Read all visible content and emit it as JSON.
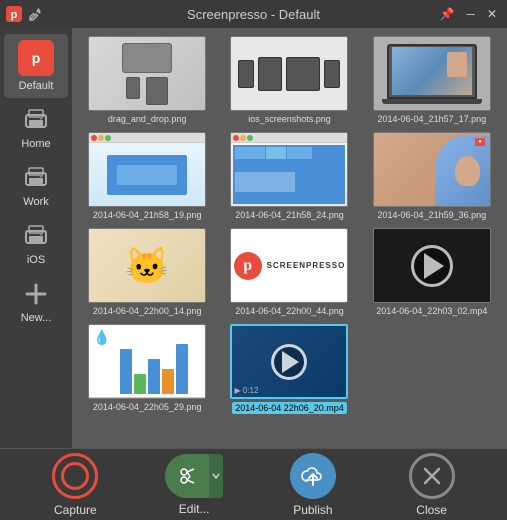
{
  "window": {
    "title": "Screenpresso  -  Default"
  },
  "title_bar": {
    "close_label": "✕",
    "minimize_label": "─",
    "pin_label": "📌"
  },
  "sidebar": {
    "items": [
      {
        "id": "default",
        "label": "Default",
        "active": true
      },
      {
        "id": "home",
        "label": "Home",
        "active": false
      },
      {
        "id": "work",
        "label": "Work",
        "active": false
      },
      {
        "id": "ios",
        "label": "iOS",
        "active": false
      },
      {
        "id": "new",
        "label": "New...",
        "active": false
      }
    ]
  },
  "thumbnails": [
    {
      "id": 0,
      "filename": "drag_and_drop.png",
      "type": "laptop",
      "selected": false
    },
    {
      "id": 1,
      "filename": "ios_screenshots.png",
      "type": "ios",
      "selected": false
    },
    {
      "id": 2,
      "filename": "2014-06-04_21h57_17.png",
      "type": "laptop-photo",
      "selected": false
    },
    {
      "id": 3,
      "filename": "2014-06-04_21h58_19.png",
      "type": "browser",
      "selected": false
    },
    {
      "id": 4,
      "filename": "2014-06-04_21h58_24.png",
      "type": "browser2",
      "selected": false
    },
    {
      "id": 5,
      "filename": "2014-06-04_21h59_36.png",
      "type": "person",
      "selected": false
    },
    {
      "id": 6,
      "filename": "2014-06-04_22h00_14.png",
      "type": "cat",
      "selected": false
    },
    {
      "id": 7,
      "filename": "2014-06-04_22h00_44.png",
      "type": "screenpresso",
      "selected": false
    },
    {
      "id": 8,
      "filename": "2014-06-04_22h03_02.mp4",
      "type": "video",
      "selected": false
    },
    {
      "id": 9,
      "filename": "2014-06-04_22h05_29.png",
      "type": "chart",
      "selected": false
    },
    {
      "id": 10,
      "filename": "2014-06-04 22h06_20.mp4",
      "type": "video2",
      "selected": true
    }
  ],
  "toolbar": {
    "capture_label": "Capture",
    "edit_label": "Edit...",
    "publish_label": "Publish",
    "close_label": "Close"
  }
}
